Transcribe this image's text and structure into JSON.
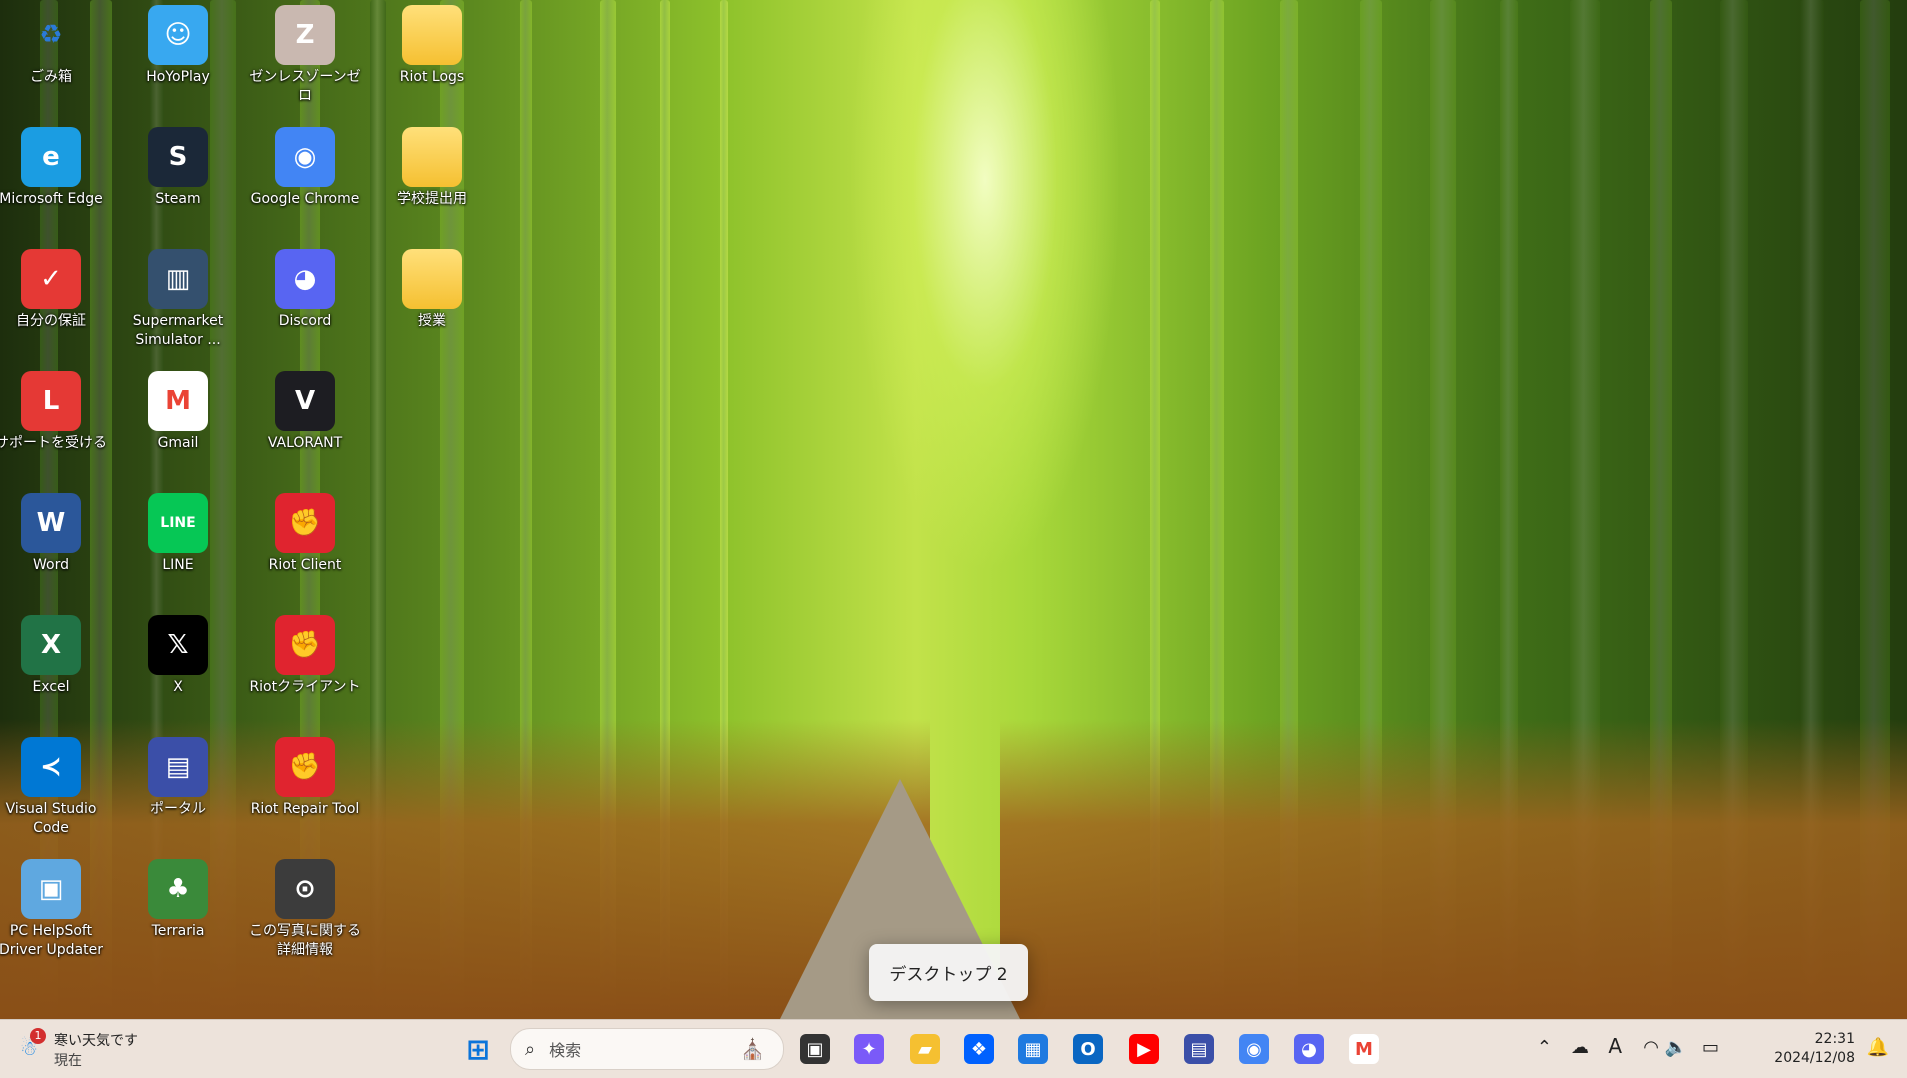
{
  "desktop": {
    "icons": [
      {
        "id": "recycle-bin",
        "label": "ごみ箱",
        "icon": "recycle-bin-icon",
        "color": "#e8f0f8",
        "glyph": "♻"
      },
      {
        "id": "hoyoplay",
        "label": "HoYoPlay",
        "icon": "hoyoplay-icon",
        "color": "#38a8f0",
        "glyph": "☺"
      },
      {
        "id": "zzz",
        "label": "ゼンレスゾーンゼロ",
        "icon": "zenless-zone-zero-icon",
        "color": "#c9b8b0",
        "glyph": "Z"
      },
      {
        "id": "riot-logs",
        "label": "Riot Logs",
        "icon": "folder-icon",
        "color": "#f5c031",
        "glyph": ""
      },
      {
        "id": "edge",
        "label": "Microsoft Edge",
        "icon": "edge-icon",
        "color": "#1b9de2",
        "glyph": "e"
      },
      {
        "id": "steam",
        "label": "Steam",
        "icon": "steam-icon",
        "color": "#1b2838",
        "glyph": "S"
      },
      {
        "id": "chrome",
        "label": "Google Chrome",
        "icon": "chrome-icon",
        "color": "#4285f4",
        "glyph": "◉"
      },
      {
        "id": "school",
        "label": "学校提出用",
        "icon": "folder-icon",
        "color": "#f5c031",
        "glyph": ""
      },
      {
        "id": "my-warranty",
        "label": "自分の保証",
        "icon": "warranty-icon",
        "color": "#e53935",
        "glyph": "✓"
      },
      {
        "id": "supermarket",
        "label": "Supermarket Simulator ...",
        "icon": "supermarket-simulator-icon",
        "color": "#34506e",
        "glyph": "▥"
      },
      {
        "id": "discord",
        "label": "Discord",
        "icon": "discord-icon",
        "color": "#5865f2",
        "glyph": "◕"
      },
      {
        "id": "classes",
        "label": "授業",
        "icon": "folder-icon",
        "color": "#f5c031",
        "glyph": ""
      },
      {
        "id": "get-support",
        "label": "サポートを受ける",
        "icon": "support-icon",
        "color": "#e53935",
        "glyph": "L"
      },
      {
        "id": "gmail",
        "label": "Gmail",
        "icon": "gmail-icon",
        "color": "#ffffff",
        "glyph": "M"
      },
      {
        "id": "valorant",
        "label": "VALORANT",
        "icon": "valorant-icon",
        "color": "#1d1d22",
        "glyph": "V"
      },
      {
        "id": "word",
        "label": "Word",
        "icon": "word-icon",
        "color": "#2b579a",
        "glyph": "W"
      },
      {
        "id": "line",
        "label": "LINE",
        "icon": "line-icon",
        "color": "#06c755",
        "glyph": "LINE"
      },
      {
        "id": "riot-client",
        "label": "Riot Client",
        "icon": "riot-client-icon",
        "color": "#e0242f",
        "glyph": "✊"
      },
      {
        "id": "excel",
        "label": "Excel",
        "icon": "excel-icon",
        "color": "#217346",
        "glyph": "X"
      },
      {
        "id": "x",
        "label": "X",
        "icon": "x-icon",
        "color": "#000000",
        "glyph": "𝕏"
      },
      {
        "id": "riot-client-jp",
        "label": "Riotクライアント",
        "icon": "riot-client-icon",
        "color": "#e0242f",
        "glyph": "✊"
      },
      {
        "id": "vscode",
        "label": "Visual Studio Code",
        "icon": "vscode-icon",
        "color": "#0078d4",
        "glyph": "≺"
      },
      {
        "id": "portal",
        "label": "ポータル",
        "icon": "portal-icon",
        "color": "#3b4fa8",
        "glyph": "▤"
      },
      {
        "id": "riot-repair",
        "label": "Riot Repair Tool",
        "icon": "riot-repair-icon",
        "color": "#e0242f",
        "glyph": "✊"
      },
      {
        "id": "helpsoft",
        "label": "PC HelpSoft Driver Updater",
        "icon": "helpsoft-icon",
        "color": "#5fa8e0",
        "glyph": "▣"
      },
      {
        "id": "terraria",
        "label": "Terraria",
        "icon": "terraria-icon",
        "color": "#3a8a3a",
        "glyph": "♣"
      },
      {
        "id": "photo-info",
        "label": "この写真に関する詳細情報",
        "icon": "camera-info-icon",
        "color": "#3c3c3c",
        "glyph": "⊙"
      }
    ]
  },
  "virtual_desktop_toast": "デスクトップ 2",
  "taskbar": {
    "weather": {
      "badge": "1",
      "line1": "寒い天気です",
      "line2": "現在"
    },
    "search_placeholder": "検索",
    "apps": [
      {
        "name": "start-button",
        "icon": "windows-start-icon",
        "color": "#0a74da",
        "glyph": "⊞"
      },
      {
        "name": "task-view-button",
        "icon": "task-view-icon",
        "color": "#333333",
        "glyph": "▣"
      },
      {
        "name": "copilot-button",
        "icon": "copilot-icon",
        "color": "#7a5af8",
        "glyph": "✦"
      },
      {
        "name": "file-explorer-button",
        "icon": "folder-icon",
        "color": "#f5c031",
        "glyph": "▰"
      },
      {
        "name": "dropbox-button",
        "icon": "dropbox-icon",
        "color": "#0061fe",
        "glyph": "❖"
      },
      {
        "name": "store-button",
        "icon": "ms-store-icon",
        "color": "#1f7ae0",
        "glyph": "▦"
      },
      {
        "name": "outlook-button",
        "icon": "outlook-icon",
        "color": "#0a66c2",
        "glyph": "O"
      },
      {
        "name": "youtube-button",
        "icon": "youtube-icon",
        "color": "#ff0000",
        "glyph": "▶"
      },
      {
        "name": "portal-button",
        "icon": "portal-icon",
        "color": "#3b4fa8",
        "glyph": "▤"
      },
      {
        "name": "chrome-button",
        "icon": "chrome-icon",
        "color": "#4285f4",
        "glyph": "◉"
      },
      {
        "name": "discord-button",
        "icon": "discord-icon",
        "color": "#5865f2",
        "glyph": "◕"
      },
      {
        "name": "gmail-button",
        "icon": "gmail-icon",
        "color": "#ea4335",
        "glyph": "M"
      }
    ],
    "tray": {
      "time": "22:31",
      "date": "2024/12/08",
      "ime": "A"
    }
  }
}
